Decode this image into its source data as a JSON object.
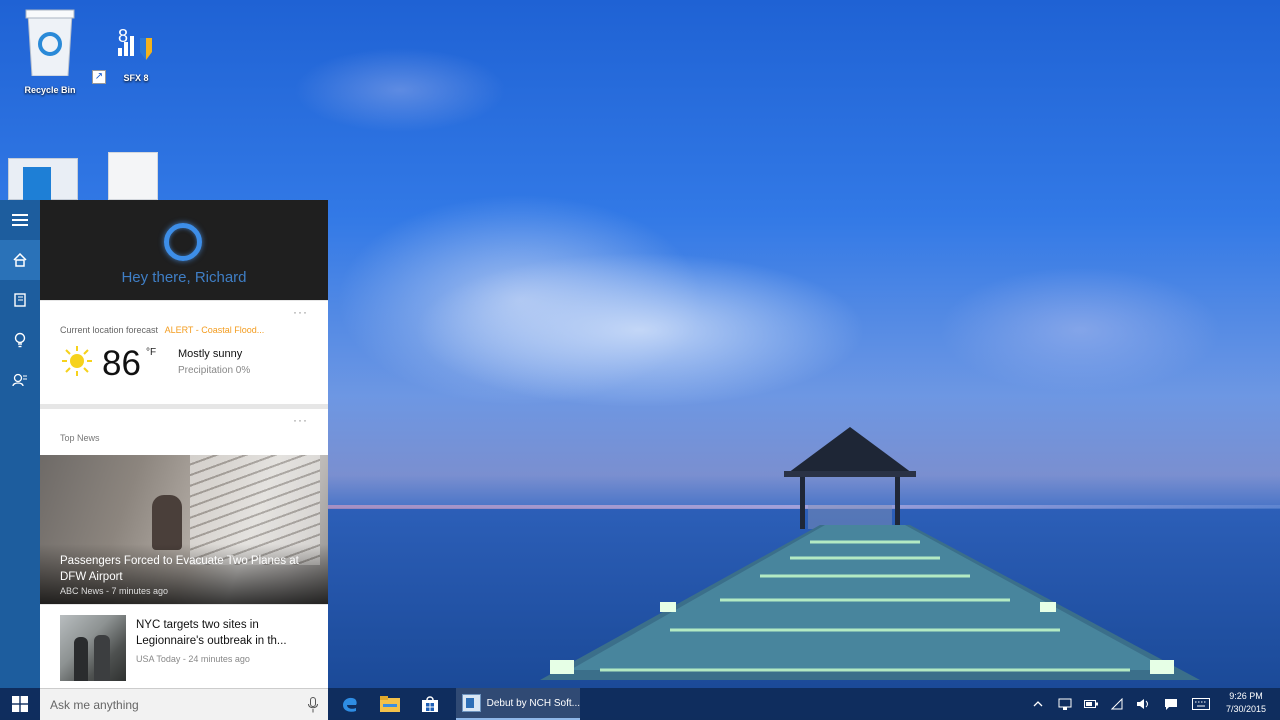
{
  "desktop": {
    "icons": [
      {
        "label": "Recycle Bin"
      },
      {
        "label": "SFX 8"
      }
    ]
  },
  "cortana": {
    "greeting": "Hey there, Richard",
    "weather": {
      "location_label": "Current location forecast",
      "alert": "ALERT - Coastal Flood...",
      "temperature": "86",
      "unit": "°F",
      "condition": "Mostly sunny",
      "precipitation": "Precipitation 0%",
      "menu": "···"
    },
    "top_news": {
      "header": "Top News",
      "menu": "···",
      "headline": "Passengers Forced to Evacuate Two Planes at DFW Airport",
      "source": "ABC News - 7 minutes ago"
    },
    "second_news": {
      "headline": "NYC targets two sites in Legionnaire's outbreak in th...",
      "source": "USA Today - 24 minutes ago"
    },
    "rail_items": [
      "menu-icon",
      "home-icon",
      "notebook-icon",
      "lightbulb-icon",
      "feedback-icon"
    ]
  },
  "search": {
    "placeholder": "Ask me anything"
  },
  "taskbar": {
    "active_app_label": "Debut by NCH Soft...",
    "clock_time": "9:26 PM",
    "clock_date": "7/30/2015",
    "pinned": [
      "edge-icon",
      "file-explorer-icon",
      "store-icon"
    ],
    "tray": [
      "chevron-up-icon",
      "network-icon",
      "battery-icon",
      "wifi-icon",
      "volume-icon",
      "notifications-icon",
      "keyboard-icon"
    ]
  },
  "colors": {
    "cortana_ring": "#3d8ee8",
    "alert": "#f39c1f",
    "rail": "#1d5d9e",
    "taskbar": "#0e2a58"
  }
}
